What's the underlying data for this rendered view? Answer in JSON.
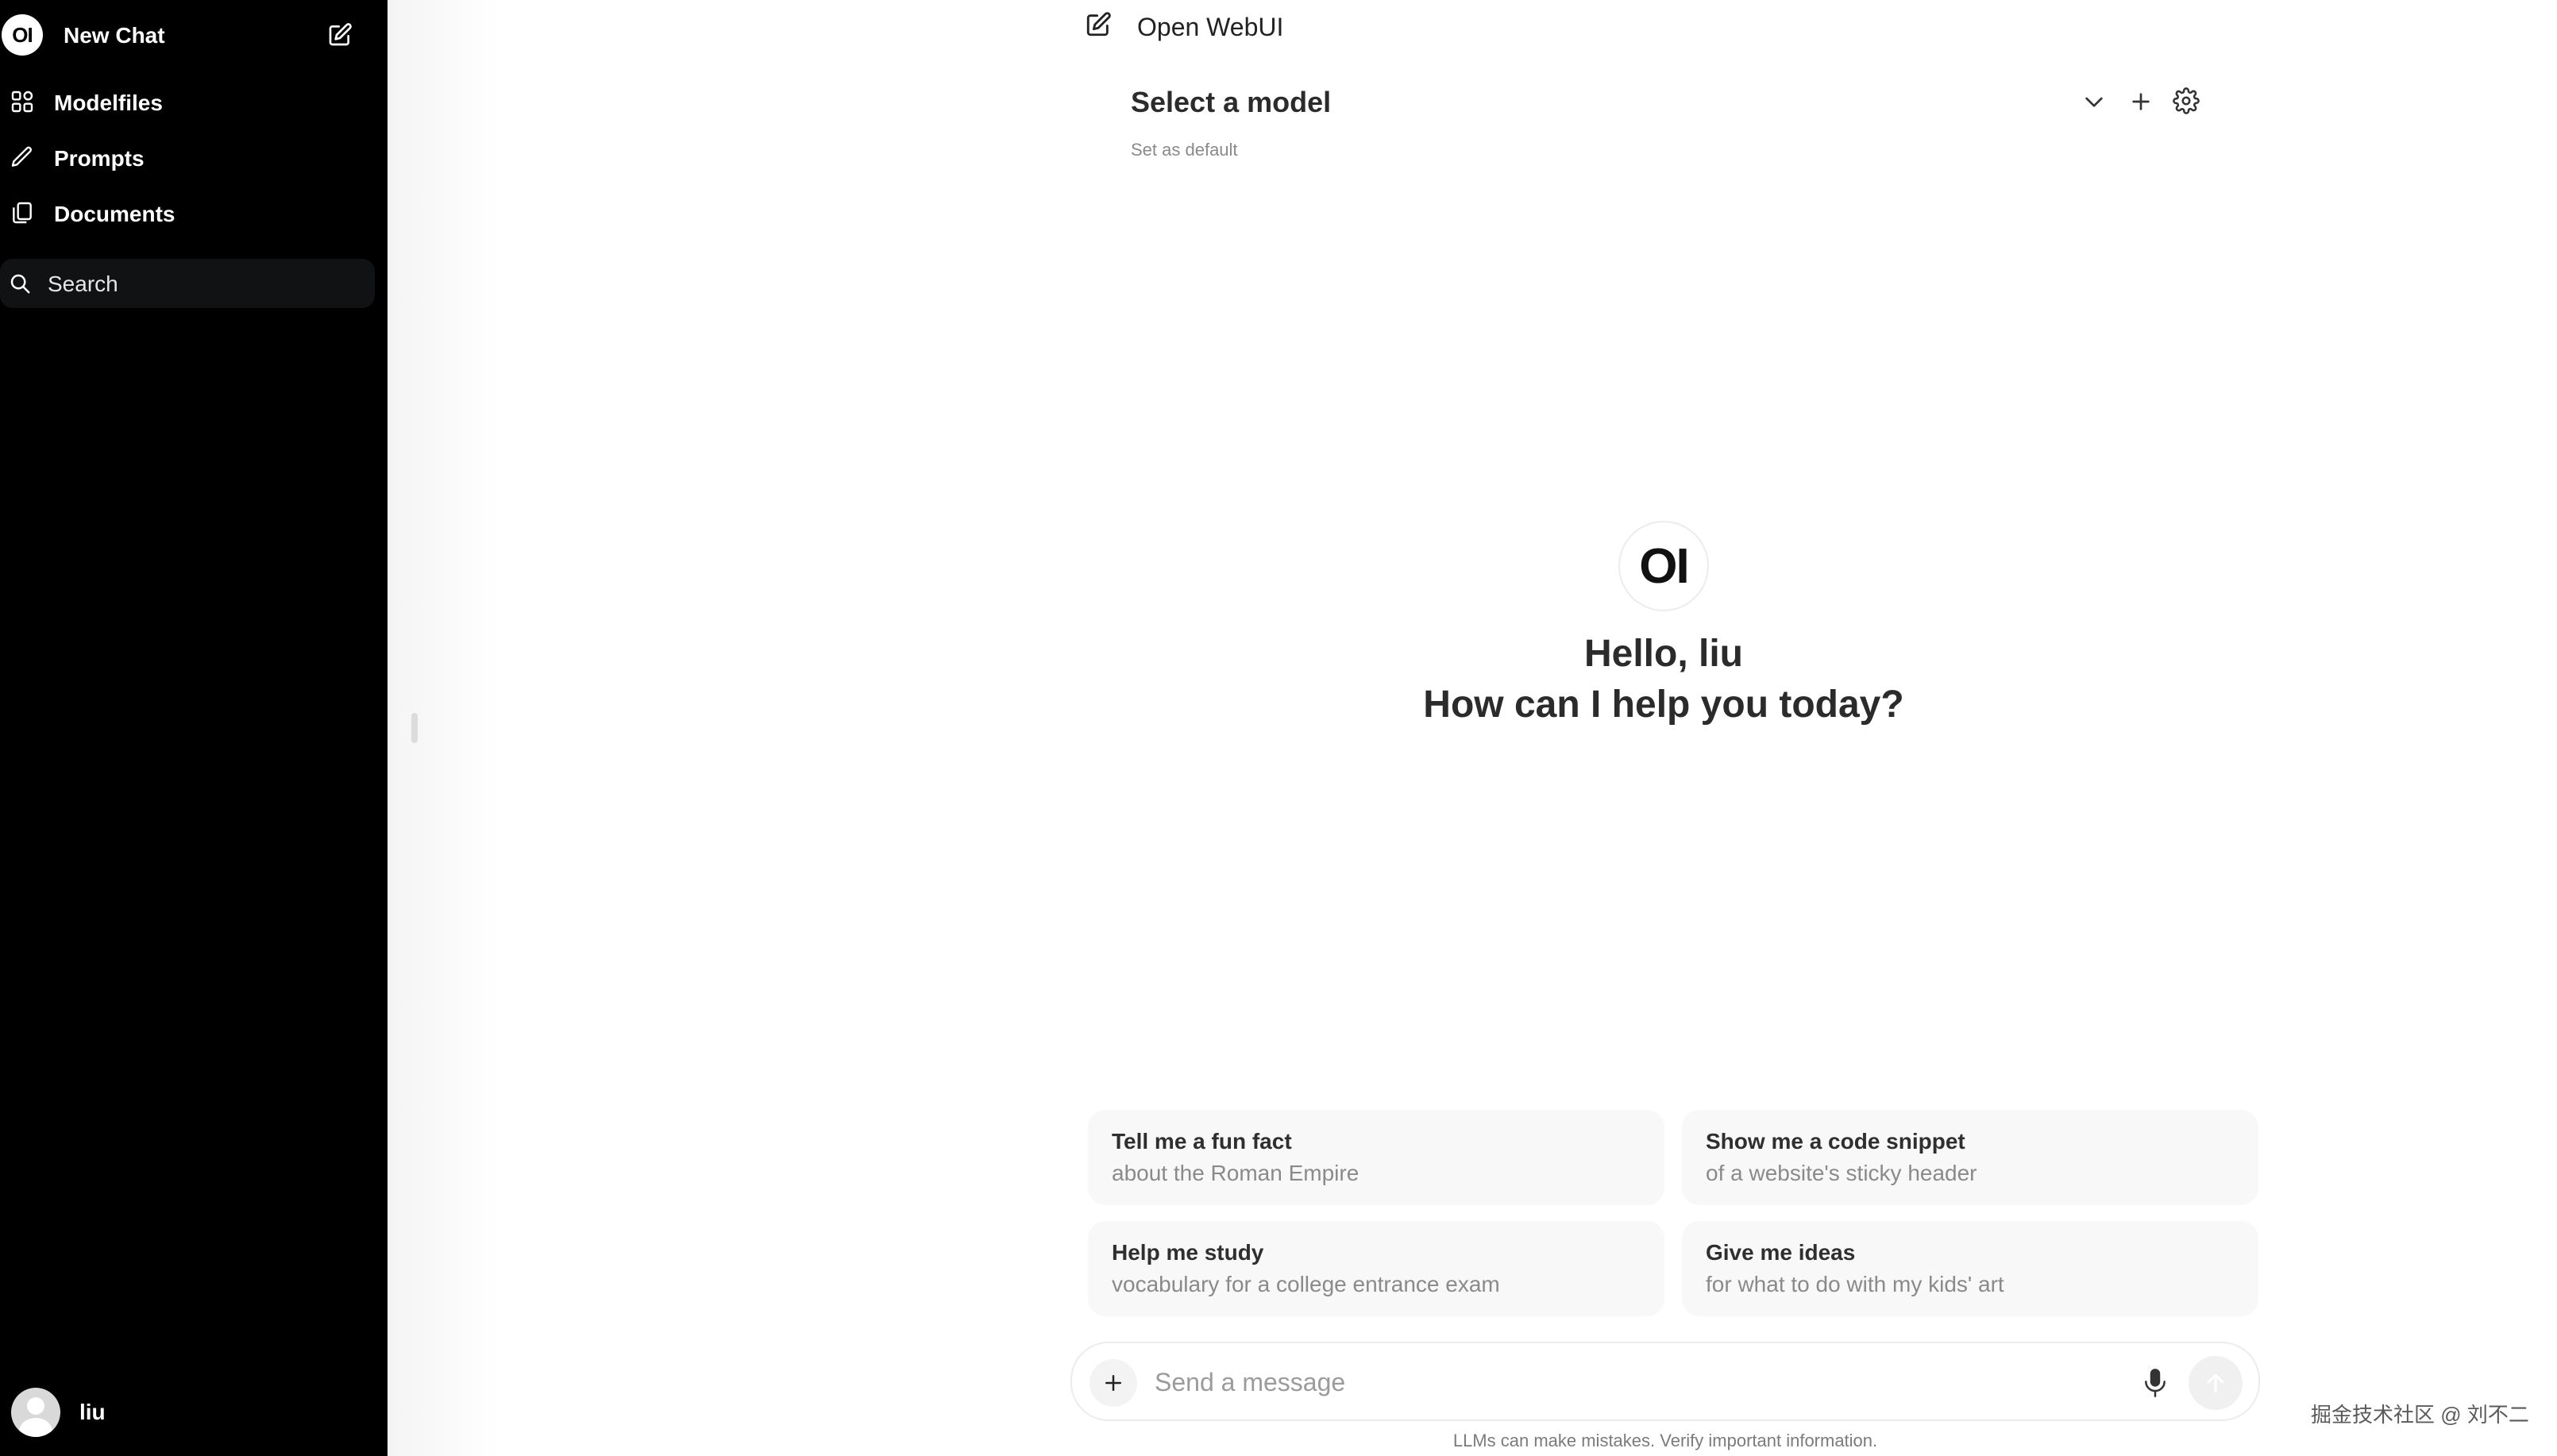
{
  "sidebar": {
    "logo_text": "OI",
    "new_chat_label": "New Chat",
    "items": [
      {
        "label": "Modelfiles",
        "icon": "grid-icon"
      },
      {
        "label": "Prompts",
        "icon": "pencil-icon"
      },
      {
        "label": "Documents",
        "icon": "documents-icon"
      }
    ],
    "search_placeholder": "Search",
    "user_name": "liu"
  },
  "header": {
    "app_name": "Open WebUI"
  },
  "model_selector": {
    "label": "Select a model",
    "set_default_label": "Set as default"
  },
  "welcome": {
    "logo_text": "OI",
    "greeting": "Hello, liu",
    "prompt": "How can I help you today?"
  },
  "suggestions": [
    {
      "title": "Tell me a fun fact",
      "subtitle": "about the Roman Empire"
    },
    {
      "title": "Show me a code snippet",
      "subtitle": "of a website's sticky header"
    },
    {
      "title": "Help me study",
      "subtitle": "vocabulary for a college entrance exam"
    },
    {
      "title": "Give me ideas",
      "subtitle": "for what to do with my kids' art"
    }
  ],
  "composer": {
    "placeholder": "Send a message",
    "disclaimer": "LLMs can make mistakes. Verify important information."
  },
  "watermark": "掘金技术社区 @ 刘不二",
  "colors": {
    "sidebar_bg": "#000000",
    "main_bg": "#ffffff",
    "suggestion_bg": "#f8f8f8",
    "muted_text": "#8a8a8a"
  }
}
